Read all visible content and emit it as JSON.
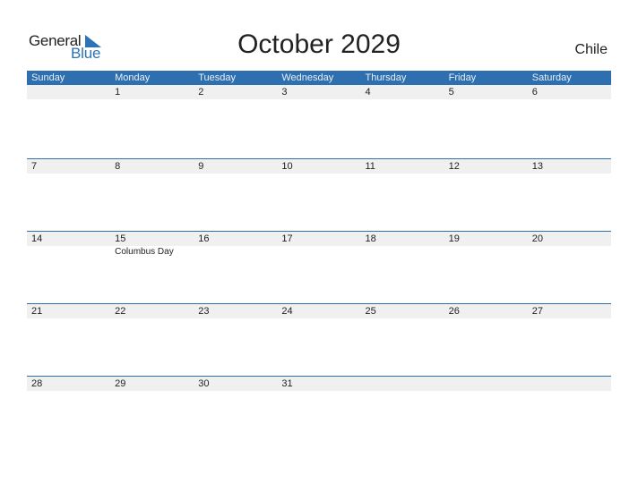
{
  "logo": {
    "general": "General",
    "blue": "Blue"
  },
  "title": "October 2029",
  "country": "Chile",
  "weekdays": [
    "Sunday",
    "Monday",
    "Tuesday",
    "Wednesday",
    "Thursday",
    "Friday",
    "Saturday"
  ],
  "weeks": [
    {
      "days": [
        "",
        "1",
        "2",
        "3",
        "4",
        "5",
        "6"
      ],
      "events": [
        "",
        "",
        "",
        "",
        "",
        "",
        ""
      ]
    },
    {
      "days": [
        "7",
        "8",
        "9",
        "10",
        "11",
        "12",
        "13"
      ],
      "events": [
        "",
        "",
        "",
        "",
        "",
        "",
        ""
      ]
    },
    {
      "days": [
        "14",
        "15",
        "16",
        "17",
        "18",
        "19",
        "20"
      ],
      "events": [
        "",
        "Columbus Day",
        "",
        "",
        "",
        "",
        ""
      ]
    },
    {
      "days": [
        "21",
        "22",
        "23",
        "24",
        "25",
        "26",
        "27"
      ],
      "events": [
        "",
        "",
        "",
        "",
        "",
        "",
        ""
      ]
    },
    {
      "days": [
        "28",
        "29",
        "30",
        "31",
        "",
        "",
        ""
      ],
      "events": [
        "",
        "",
        "",
        "",
        "",
        "",
        ""
      ]
    }
  ]
}
